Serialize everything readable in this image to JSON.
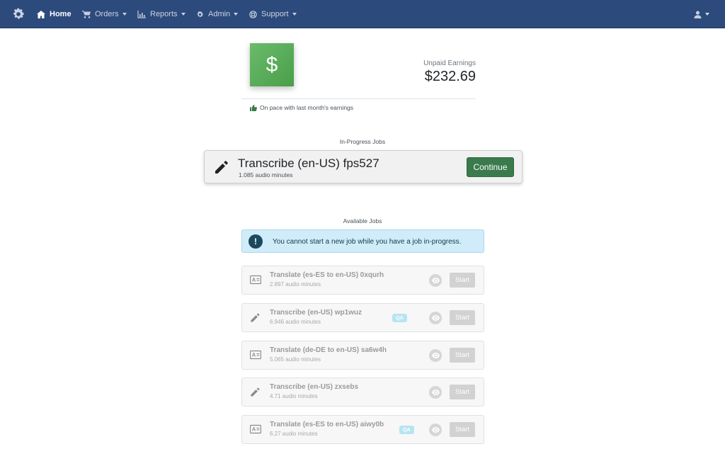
{
  "nav": {
    "home": "Home",
    "orders": "Orders",
    "reports": "Reports",
    "admin": "Admin",
    "support": "Support"
  },
  "earnings": {
    "label": "Unpaid Earnings",
    "value": "$232.69",
    "pace": "On pace with last month's earnings",
    "icon_symbol": "$"
  },
  "in_progress": {
    "heading": "In-Progress Jobs",
    "title": "Transcribe (en-US) fps527",
    "subtitle": "1.085 audio minutes",
    "button": "Continue"
  },
  "available": {
    "heading": "Available Jobs",
    "alert_icon": "!",
    "alert": "You cannot start a new job while you have a job in-progress.",
    "jobs": [
      {
        "icon": "translate-icon",
        "title": "Translate (es-ES to en-US) 0xqurh",
        "subtitle": "2.897 audio minutes",
        "badge": "",
        "start": "Start"
      },
      {
        "icon": "pencil-icon",
        "title": "Transcribe (en-US) wp1wuz",
        "subtitle": "6.946 audio minutes",
        "badge": "QA",
        "start": "Start"
      },
      {
        "icon": "translate-icon",
        "title": "Translate (de-DE to en-US) sa6w4h",
        "subtitle": "5.065 audio minutes",
        "badge": "",
        "start": "Start"
      },
      {
        "icon": "pencil-icon",
        "title": "Transcribe (en-US) zxsebs",
        "subtitle": "4.71 audio minutes",
        "badge": "",
        "start": "Start"
      },
      {
        "icon": "translate-icon",
        "title": "Translate (es-ES to en-US) aiwy0b",
        "subtitle": "6.27 audio minutes",
        "badge": "QA",
        "start": "Start"
      }
    ]
  },
  "colors": {
    "navbar": "#2c4a7c",
    "earnings_green": "#5aad5a",
    "continue_green": "#3a7a4c",
    "alert_bg": "#d1ecf9"
  }
}
